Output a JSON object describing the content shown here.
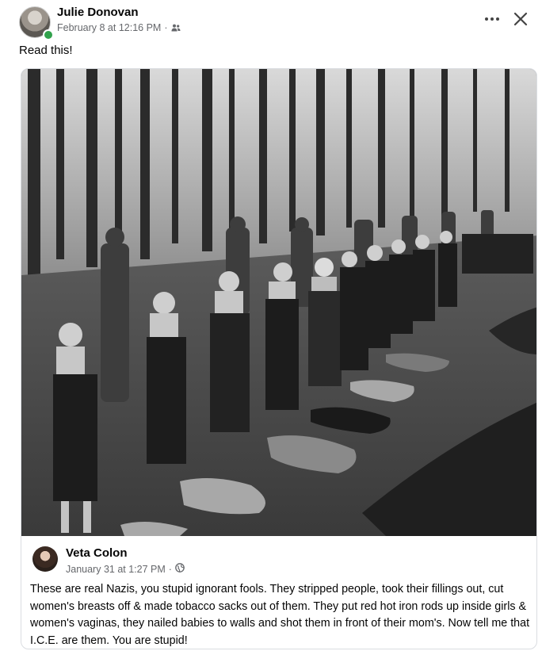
{
  "post": {
    "author_name": "Julie Donovan",
    "timestamp": "February 8 at 12:16 PM",
    "separator": "·",
    "audience_icon": "friends-icon",
    "text": "Read this!"
  },
  "actions": {
    "more_icon": "ellipsis-icon",
    "close_icon": "close-icon"
  },
  "shared_post": {
    "author_name": "Veta Colon",
    "timestamp": "January 31 at 1:27 PM",
    "separator": "·",
    "audience_icon": "globe-icon",
    "text": "These are real Nazis, you stupid ignorant fools. They stripped people, took their fillings out, cut women's breasts off & made tobacco sacks out of them. They put red hot iron rods up inside girls & women's vaginas, they nailed babies to walls and shot them in front of their mom's. Now tell me that I.C.E. are them. You are stupid!"
  },
  "colors": {
    "online": "#31a24c",
    "meta_text": "#65676b"
  }
}
